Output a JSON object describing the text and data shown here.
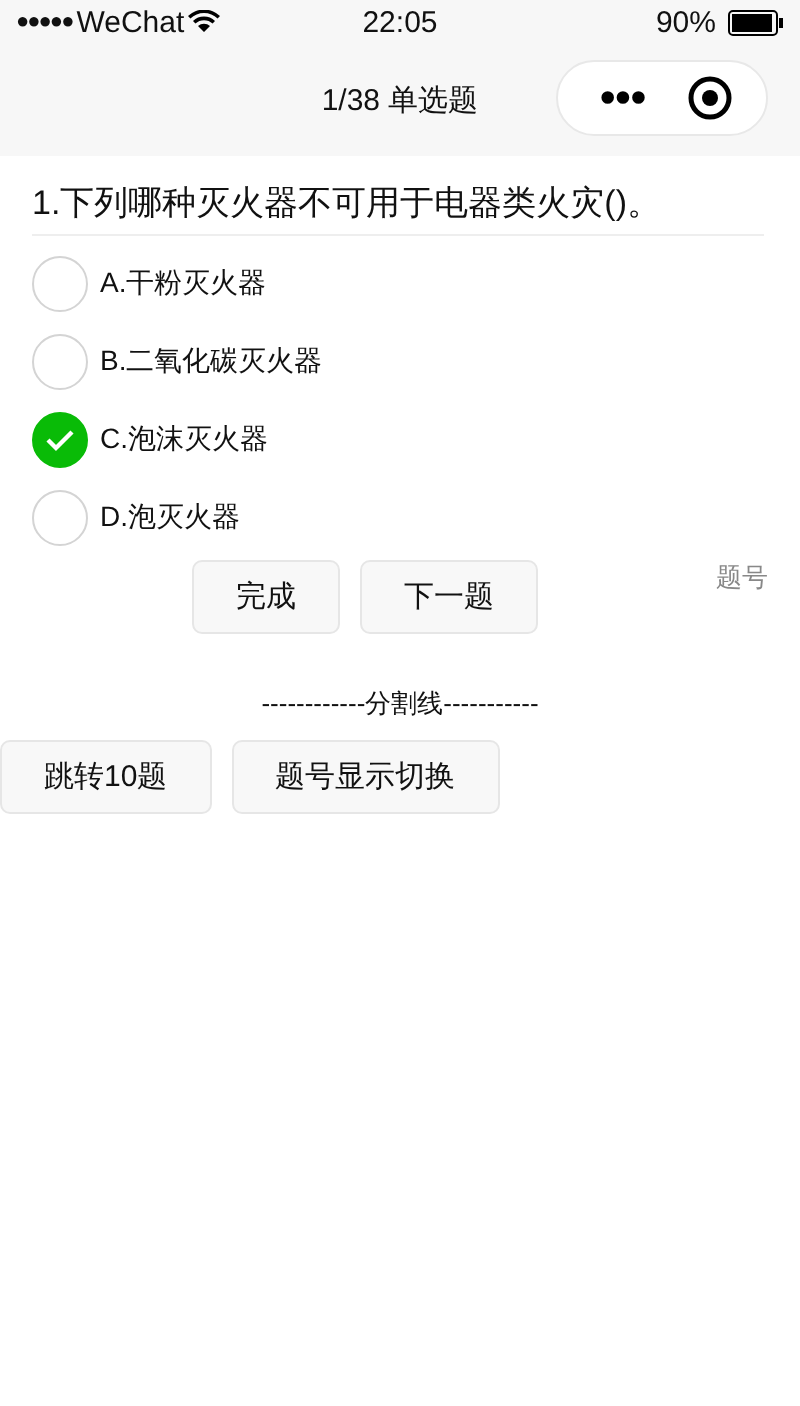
{
  "status_bar": {
    "signal": "●●●●●",
    "carrier": "WeChat",
    "time": "22:05",
    "battery": "90%"
  },
  "nav_bar": {
    "title": "1/38 单选题",
    "more": "•••"
  },
  "question": {
    "text": "1.下列哪种灭火器不可用于电器类火灾()。",
    "options": [
      {
        "label": "A.干粉灭火器",
        "selected": false
      },
      {
        "label": "B.二氧化碳灭火器",
        "selected": false
      },
      {
        "label": "C.泡沫灭火器",
        "selected": true
      },
      {
        "label": "D.泡灭火器",
        "selected": false
      }
    ]
  },
  "actions": [
    "完成",
    "下一题"
  ],
  "number_label": "题号",
  "divider": "------------分割线-----------",
  "bottom_buttons": [
    "跳转10题",
    "题号显示切换"
  ]
}
